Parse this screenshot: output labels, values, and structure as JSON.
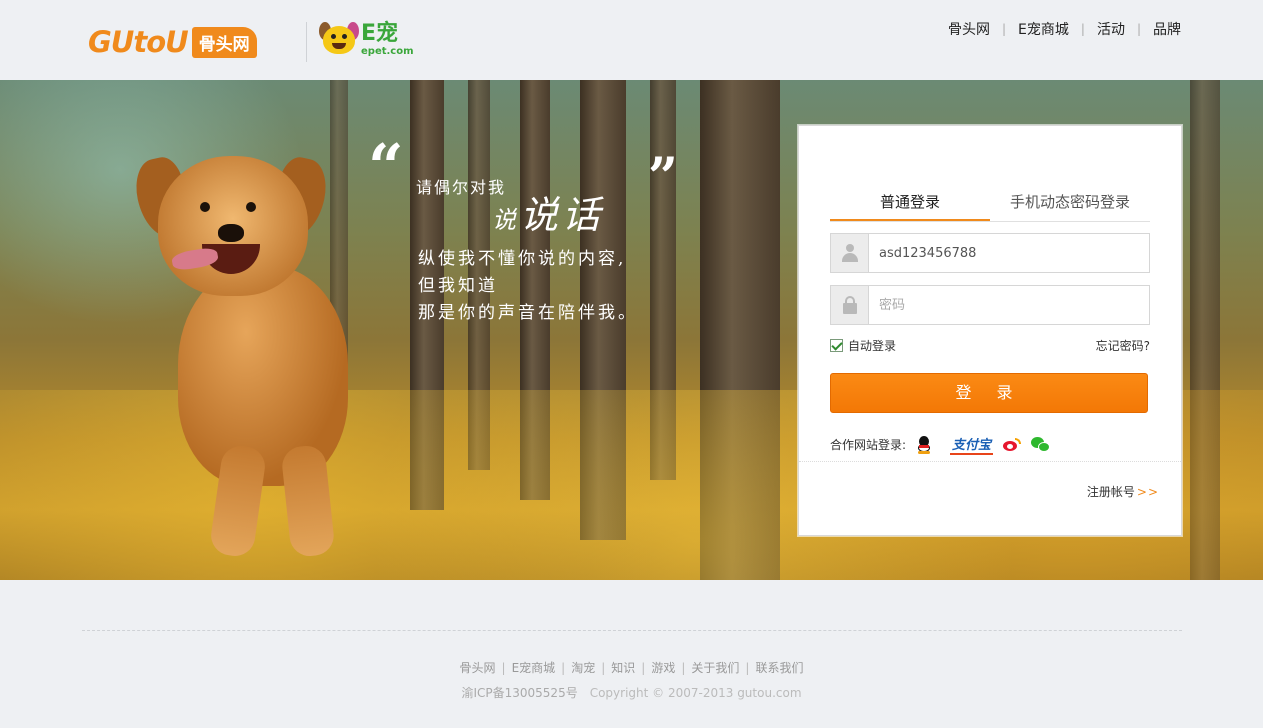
{
  "header": {
    "logo_gutou": {
      "word": "GUtoU",
      "cn": "骨头网"
    },
    "logo_epet": {
      "cn": "E宠",
      "en": "epet.com"
    },
    "nav": [
      "骨头网",
      "E宠商城",
      "活动",
      "品牌"
    ]
  },
  "banner": {
    "quote_open": "“",
    "quote_close": "”",
    "line1": "请偶尔对我",
    "line2_small": "说",
    "line2_big": "说话",
    "poem": [
      "纵使我不懂你说的内容,",
      "但我知道",
      "那是你的声音在陪伴我。"
    ]
  },
  "login": {
    "tabs": [
      "普通登录",
      "手机动态密码登录"
    ],
    "username_value": "asd123456788",
    "password_placeholder": "密码",
    "auto_login_label": "自动登录",
    "auto_login_checked": true,
    "forgot_label": "忘记密码?",
    "submit_label": "登 录",
    "partner_label": "合作网站登录:",
    "partners": [
      "qq-icon",
      "alipay-icon",
      "weibo-icon",
      "wechat-icon"
    ],
    "alipay_text": "支付宝",
    "register_label": "注册帐号",
    "register_arrow": ">>"
  },
  "footer": {
    "links": [
      "骨头网",
      "E宠商城",
      "淘宠",
      "知识",
      "游戏",
      "关于我们",
      "联系我们"
    ],
    "icp": "渝ICP备13005525号",
    "copyright": "Copyright © 2007-2013 gutou.com"
  },
  "colors": {
    "accent": "#f08a1c",
    "button": "#f37806",
    "brand_green": "#3aa63a",
    "page_bg": "#eef0f3"
  }
}
